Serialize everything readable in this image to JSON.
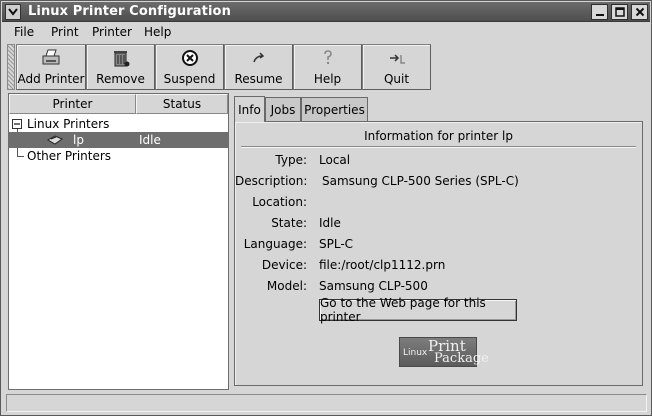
{
  "window": {
    "title": "Linux Printer Configuration"
  },
  "menubar": {
    "items": [
      "File",
      "Print",
      "Printer",
      "Help"
    ]
  },
  "toolbar": {
    "buttons": [
      {
        "label": "Add Printer",
        "icon": "printer-add-icon"
      },
      {
        "label": "Remove",
        "icon": "trash-icon"
      },
      {
        "label": "Suspend",
        "icon": "suspend-icon"
      },
      {
        "label": "Resume",
        "icon": "resume-arrow-icon"
      },
      {
        "label": "Help",
        "icon": "help-question-icon"
      },
      {
        "label": "Quit",
        "icon": "quit-arrow-icon"
      }
    ]
  },
  "tree": {
    "columns": [
      "Printer",
      "Status"
    ],
    "groups": {
      "linux": "Linux Printers",
      "other": "Other Printers"
    },
    "printer": {
      "name": "lp",
      "status": "Idle"
    }
  },
  "tabs": [
    "Info",
    "Jobs",
    "Properties"
  ],
  "info": {
    "heading": "Information for printer lp",
    "fields": [
      {
        "label": "Type:",
        "value": "Local"
      },
      {
        "label": "Description:",
        "value": "Samsung CLP-500 Series (SPL-C)"
      },
      {
        "label": "Location:",
        "value": ""
      },
      {
        "label": "State:",
        "value": "Idle"
      },
      {
        "label": "Language:",
        "value": "SPL-C"
      },
      {
        "label": "Device:",
        "value": "file:/root/clp1112.prn"
      },
      {
        "label": "Model:",
        "value": "Samsung CLP-500"
      }
    ],
    "web_button": "Go to the Web page for this printer",
    "logo": {
      "line1": "Linux",
      "line2": "Print",
      "line3": "Package"
    }
  },
  "colors": {
    "selection": "#6e6e6e",
    "titlebar": "#5a5a5a",
    "background": "#d6d6d6"
  }
}
